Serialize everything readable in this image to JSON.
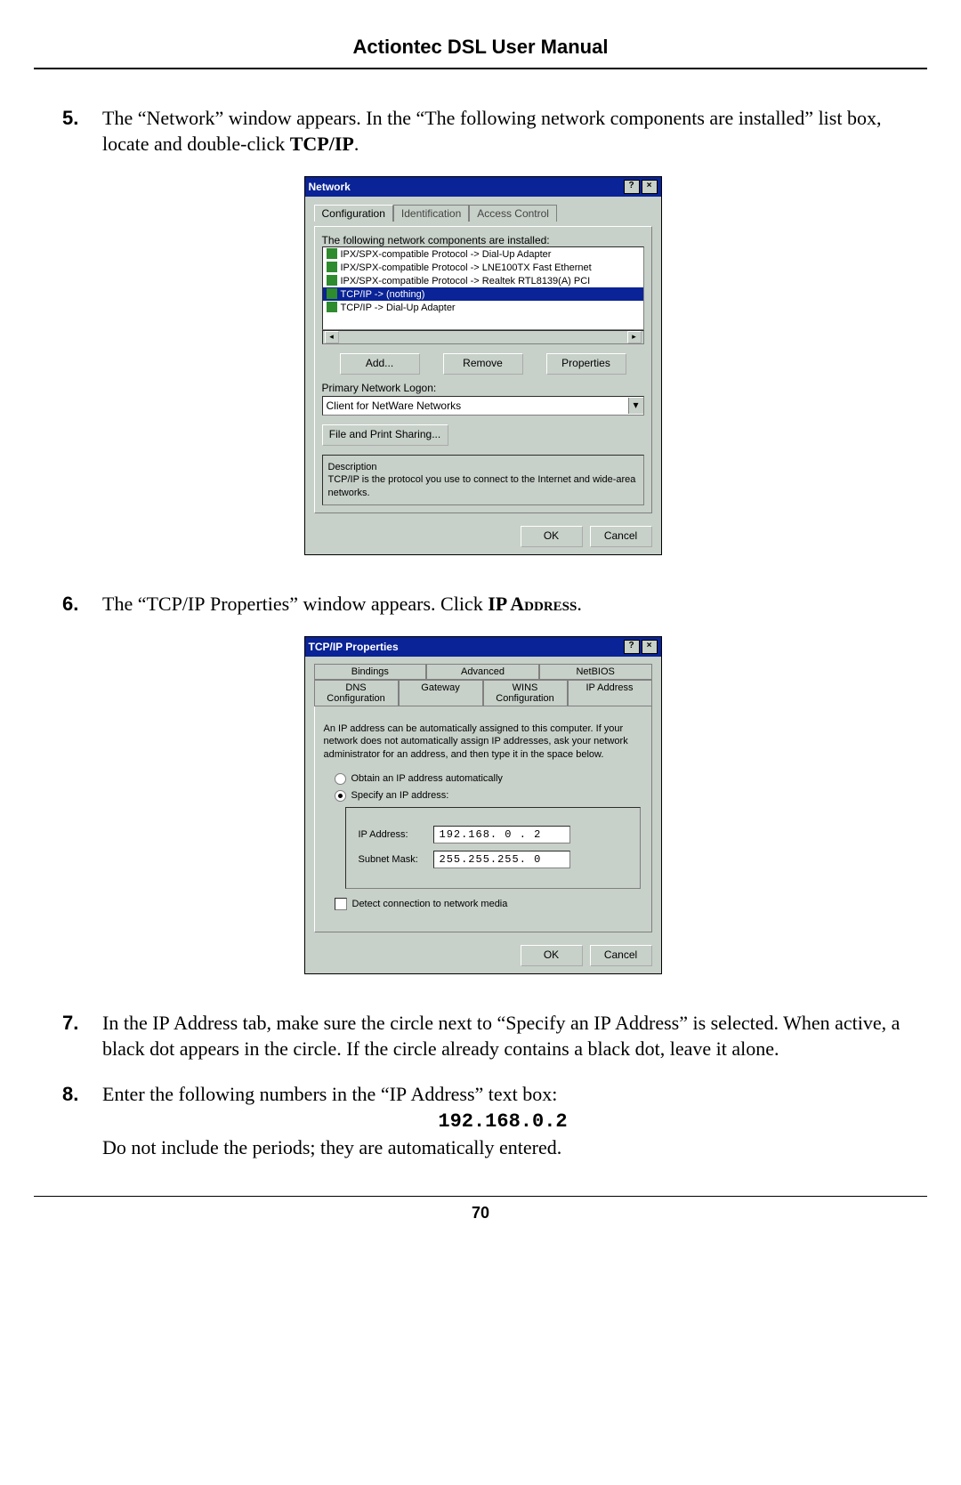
{
  "header": {
    "title": "Actiontec DSL User Manual"
  },
  "steps": {
    "s5": {
      "num": "5.",
      "text_a": "The “Network” window appears. In the “The following network components are installed” list box, locate and double-click ",
      "text_b": "TCP/IP",
      "text_c": "."
    },
    "s6": {
      "num": "6.",
      "text_a": "The “",
      "text_b": "TCP/IP",
      "text_c": " Properties” window appears. Click ",
      "text_d": "IP Address",
      "text_e": "."
    },
    "s7": {
      "num": "7.",
      "text_a": "In the ",
      "text_b": "IP",
      "text_c": " Address tab, make sure the circle next to “Specify an ",
      "text_d": "IP",
      "text_e": " Address” is selected. When active, a black dot appears in the circle. If the circle already contains a black dot, leave it alone."
    },
    "s8": {
      "num": "8.",
      "text_a": "Enter the following numbers in the “",
      "text_b": "IP",
      "text_c": " Address” text box:",
      "ip": "192.168.0.2",
      "text_d": "Do not include the periods; they are automatically entered."
    }
  },
  "page_number": "70",
  "dialog_network": {
    "title": "Network",
    "help_btn": "?",
    "close_btn": "×",
    "tabs": {
      "t1": "Configuration",
      "t2": "Identification",
      "t3": "Access Control"
    },
    "list_caption": "The following network components are installed:",
    "rows": {
      "r1": "IPX/SPX-compatible Protocol -> Dial-Up Adapter",
      "r2": "IPX/SPX-compatible Protocol -> LNE100TX Fast Ethernet",
      "r3": "IPX/SPX-compatible Protocol -> Realtek RTL8139(A) PCI",
      "r4": "TCP/IP -> (nothing)",
      "r5": "TCP/IP -> Dial-Up Adapter"
    },
    "btn_add": "Add...",
    "btn_remove": "Remove",
    "btn_props": "Properties",
    "primary_label": "Primary Network Logon:",
    "primary_value": "Client for NetWare Networks",
    "fileshare_btn": "File and Print Sharing...",
    "desc_title": "Description",
    "desc_text": "TCP/IP is the protocol you use to connect to the Internet and wide-area networks.",
    "ok": "OK",
    "cancel": "Cancel"
  },
  "dialog_tcpip": {
    "title": "TCP/IP Properties",
    "help_btn": "?",
    "close_btn": "×",
    "tabs_top": {
      "t1": "Bindings",
      "t2": "Advanced",
      "t3": "NetBIOS"
    },
    "tabs_bottom": {
      "t1": "DNS Configuration",
      "t2": "Gateway",
      "t3": "WINS Configuration",
      "t4": "IP Address"
    },
    "infotext": "An IP address can be automatically assigned to this computer. If your network does not automatically assign IP addresses, ask your network administrator for an address, and then type it in the space below.",
    "radio_auto": "Obtain an IP address automatically",
    "radio_spec": "Specify an IP address:",
    "label_ip": "IP Address:",
    "value_ip": "192.168. 0 . 2",
    "label_mask": "Subnet Mask:",
    "value_mask": "255.255.255. 0",
    "checkbox": "Detect connection to network media",
    "ok": "OK",
    "cancel": "Cancel"
  }
}
